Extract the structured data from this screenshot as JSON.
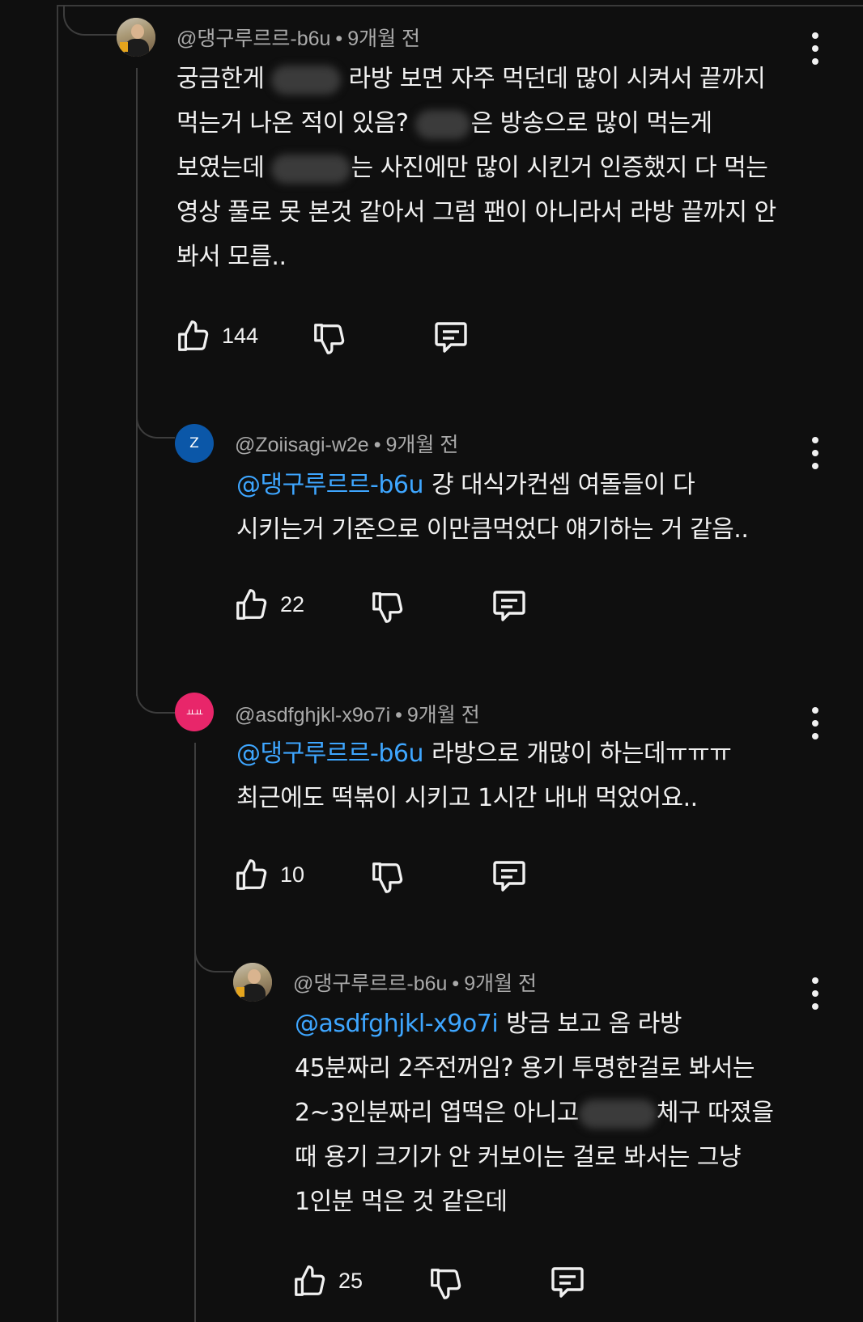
{
  "comments": [
    {
      "author": "@댕구루르르-b6u",
      "time": "9개월 전",
      "separator": "•",
      "lines": [
        [
          "궁금한게 ",
          "",
          " 라방 보면 자주 먹던데 많이 시켜서 끝까지"
        ],
        [
          "먹는거 나온 적이 있음? ",
          "",
          "은 방송으로 많이 먹는게"
        ],
        [
          "보였는데 ",
          "",
          "는 사진에만 많이 시킨거 인증했지 다 먹는"
        ],
        [
          "영상 풀로 못 본것 같아서 그럼 팬이 아니라서 라방 끝까지 안"
        ],
        [
          "봐서 모름.."
        ]
      ],
      "likes": "144"
    },
    {
      "author": "@Zoiisagi-w2e",
      "avatar_letter": "Z",
      "time": "9개월 전",
      "separator": "•",
      "mention": "@댕구루르르-b6u",
      "lines": [
        "걍 대식가컨셉 여돌들이 다",
        "시키는거 기준으로 이만큼먹었다 얘기하는 거 같음.."
      ],
      "likes": "22"
    },
    {
      "author": "@asdfghjkl-x9o7i",
      "avatar_letter": "ㅛㅛ",
      "time": "9개월 전",
      "separator": "•",
      "mention": "@댕구루르르-b6u",
      "lines": [
        "라방으로 개많이 하는데ㅠㅠㅠ",
        "최근에도 떡볶이 시키고 1시간 내내 먹었어요.."
      ],
      "likes": "10"
    },
    {
      "author": "@댕구루르르-b6u",
      "time": "9개월 전",
      "separator": "•",
      "mention": "@asdfghjkl-x9o7i",
      "lines": [
        [
          "방금 보고 옴 라방"
        ],
        [
          "45분짜리 2주전꺼임? 용기 투명한걸로 봐서는"
        ],
        [
          "2~3인분짜리 엽떡은 아니고",
          "",
          "체구 따졌을"
        ],
        [
          "때 용기 크기가 안 커보이는 걸로 봐서는 그냥"
        ],
        [
          "1인분 먹은 것 같은데"
        ]
      ],
      "likes": "25"
    }
  ],
  "icons": [
    "thumbs-up-icon",
    "thumbs-down-icon",
    "reply-icon",
    "more-vert-icon"
  ],
  "colors": {
    "background": "#0f0f0f",
    "mention": "#3ea6ff",
    "meta": "#aaaaaa",
    "text": "#f1f1f1"
  }
}
